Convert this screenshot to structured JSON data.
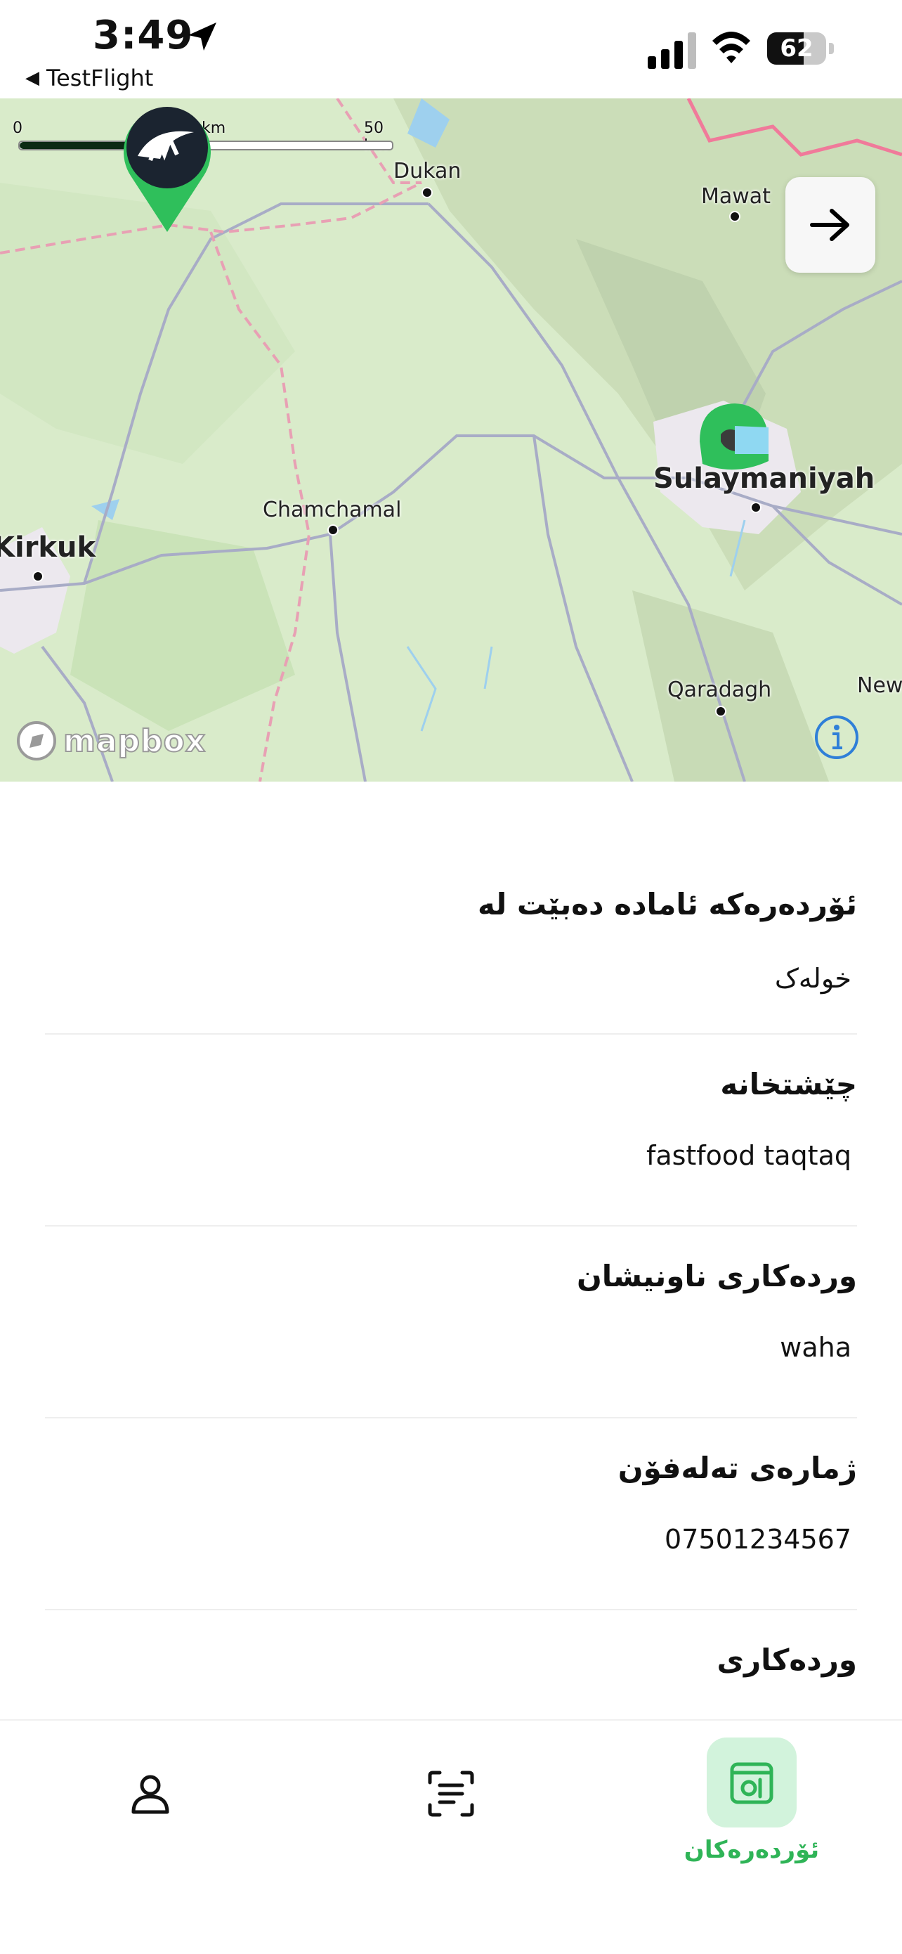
{
  "status_bar": {
    "time": "3:49",
    "back_app": "TestFlight",
    "battery": "62",
    "battery_level": 0.62
  },
  "map": {
    "scale": {
      "zero": "0",
      "mid": "25 km",
      "max": "50 km"
    },
    "places": {
      "dukan": "Dukan",
      "mawat": "Mawat",
      "chamchamal": "Chamchamal",
      "sulaymaniyah": "Sulaymaniyah",
      "kirkuk": "Kirkuk",
      "qaradagh": "Qaradagh",
      "new": "New"
    },
    "attribution": "mapbox"
  },
  "details": {
    "pickup": {
      "label": "ئۆردەرەکە ئامادە دەبێت لە",
      "value": "خولەک"
    },
    "restaurant": {
      "label": "چێشتخانە",
      "value": "fastfood taqtaq"
    },
    "address": {
      "label": "وردەکاری ناونیشان",
      "value": "waha"
    },
    "phone": {
      "label": "ژمارەی تەلەفۆن",
      "value": "07501234567"
    },
    "more": {
      "label": "وردەکاری"
    }
  },
  "nav": {
    "orders_label": "ئۆردەرەکان"
  },
  "colors": {
    "accent": "#2fb457",
    "accent_bg": "#d2f3dc",
    "map_green": "#dbeccd"
  }
}
